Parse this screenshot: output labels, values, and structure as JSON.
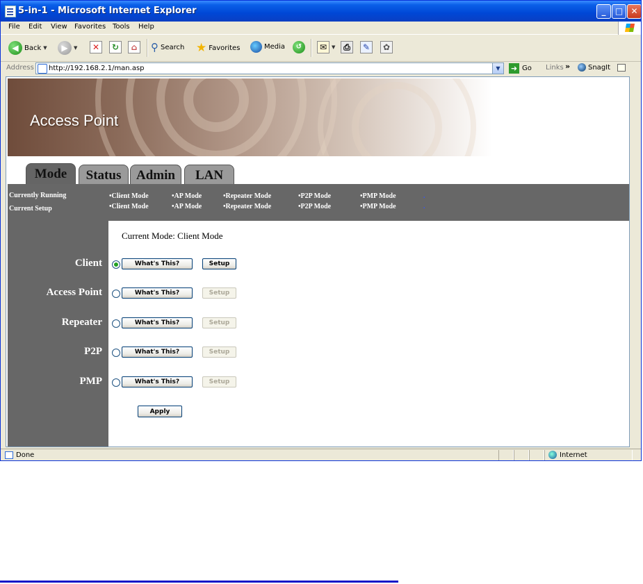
{
  "window": {
    "title": "5-in-1 - Microsoft Internet Explorer"
  },
  "menu": {
    "items": [
      "File",
      "Edit",
      "View",
      "Favorites",
      "Tools",
      "Help"
    ]
  },
  "toolbar": {
    "back": "Back",
    "search": "Search",
    "favorites": "Favorites",
    "media": "Media"
  },
  "address": {
    "label": "Address",
    "url": "http://192.168.2.1/man.asp",
    "go": "Go",
    "links": "Links",
    "snagit": "SnagIt"
  },
  "banner": {
    "title": "Access Point"
  },
  "tabs": [
    "Mode",
    "Status",
    "Admin",
    "LAN"
  ],
  "status_strip": {
    "running_label": "Currently Running",
    "setup_label": "Current Setup",
    "running_modes": [
      "•Client Mode",
      "•AP Mode",
      "•Repeater Mode",
      "•P2P Mode",
      "•PMP Mode"
    ],
    "setup_modes": [
      "•Client Mode",
      "•AP Mode",
      "•Repeater Mode",
      "•P2P Mode",
      "•PMP Mode"
    ]
  },
  "main": {
    "current_mode": "Current Mode: Client Mode",
    "whats_this": "What's This?",
    "setup": "Setup",
    "apply": "Apply",
    "modes": [
      {
        "label": "Client",
        "selected": true,
        "setup_enabled": true
      },
      {
        "label": "Access Point",
        "selected": false,
        "setup_enabled": false
      },
      {
        "label": "Repeater",
        "selected": false,
        "setup_enabled": false
      },
      {
        "label": "P2P",
        "selected": false,
        "setup_enabled": false
      },
      {
        "label": "PMP",
        "selected": false,
        "setup_enabled": false
      }
    ]
  },
  "statusbar": {
    "text": "Done",
    "zone": "Internet"
  },
  "colors": {
    "panel_grey": "#676767",
    "tab_grey": "#9a9a9a",
    "xp_title_blue": "#0047d6",
    "footer_rule": "#1515c8"
  }
}
